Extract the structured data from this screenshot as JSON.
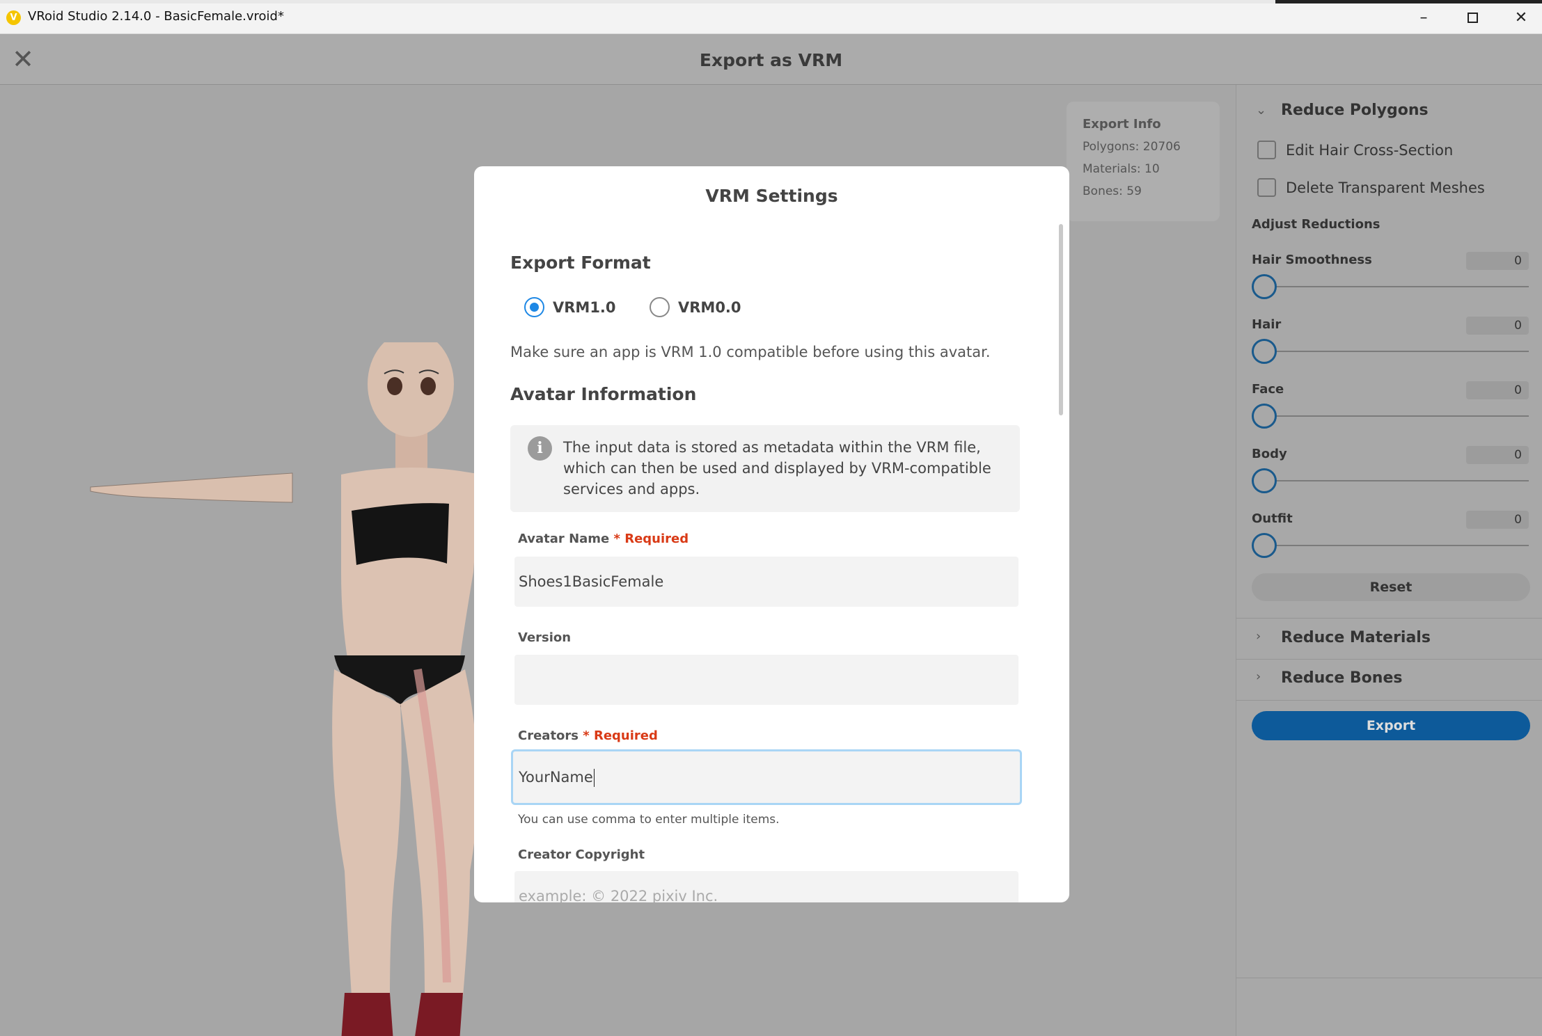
{
  "window": {
    "title": "VRoid Studio 2.14.0 - BasicFemale.vroid*",
    "minimize": "–",
    "close": "✕"
  },
  "header": {
    "title": "Export as VRM",
    "close": "✕"
  },
  "export_info": {
    "heading": "Export Info",
    "polygons": "Polygons: 20706",
    "materials": "Materials: 10",
    "bones": "Bones: 59"
  },
  "right_panel": {
    "reduce_polygons": "Reduce Polygons",
    "edit_hair_cross_section": "Edit Hair Cross-Section",
    "delete_transparent_meshes": "Delete Transparent Meshes",
    "adjust_reductions": "Adjust Reductions",
    "sliders": [
      {
        "label": "Hair Smoothness",
        "value": "0"
      },
      {
        "label": "Hair",
        "value": "0"
      },
      {
        "label": "Face",
        "value": "0"
      },
      {
        "label": "Body",
        "value": "0"
      },
      {
        "label": "Outfit",
        "value": "0"
      }
    ],
    "reset": "Reset",
    "reduce_materials": "Reduce Materials",
    "reduce_bones": "Reduce Bones",
    "export": "Export"
  },
  "modal": {
    "title": "VRM Settings",
    "export_format": "Export Format",
    "format_options": [
      "VRM1.0",
      "VRM0.0"
    ],
    "selected_format": "VRM1.0",
    "compat_note": "Make sure an app is VRM 1.0 compatible before using this avatar.",
    "avatar_information": "Avatar Information",
    "info_text": "The input data is stored as metadata within the VRM file, which can then be used and displayed by VRM-compatible services and apps.",
    "info_icon": "i",
    "required": "* Required",
    "avatar_name_label": "Avatar Name",
    "avatar_name_value": "Shoes1BasicFemale",
    "version_label": "Version",
    "version_value": "",
    "creators_label": "Creators",
    "creators_value": "YourName",
    "creators_hint": "You can use comma to enter multiple items.",
    "creator_copyright_label": "Creator Copyright",
    "creator_copyright_placeholder": "example: ©      2022 pixiv Inc."
  },
  "colors": {
    "accent_blue": "#1e88e5",
    "export_button": "#0d5a9a",
    "required_red": "#d93a16",
    "active_input_border": "#a9d5f5"
  },
  "icons": {
    "app": "vroid-logo-icon",
    "close": "close-icon",
    "chevron_down": "chevron-down-icon",
    "chevron_right": "chevron-right-icon",
    "info": "info-icon"
  }
}
